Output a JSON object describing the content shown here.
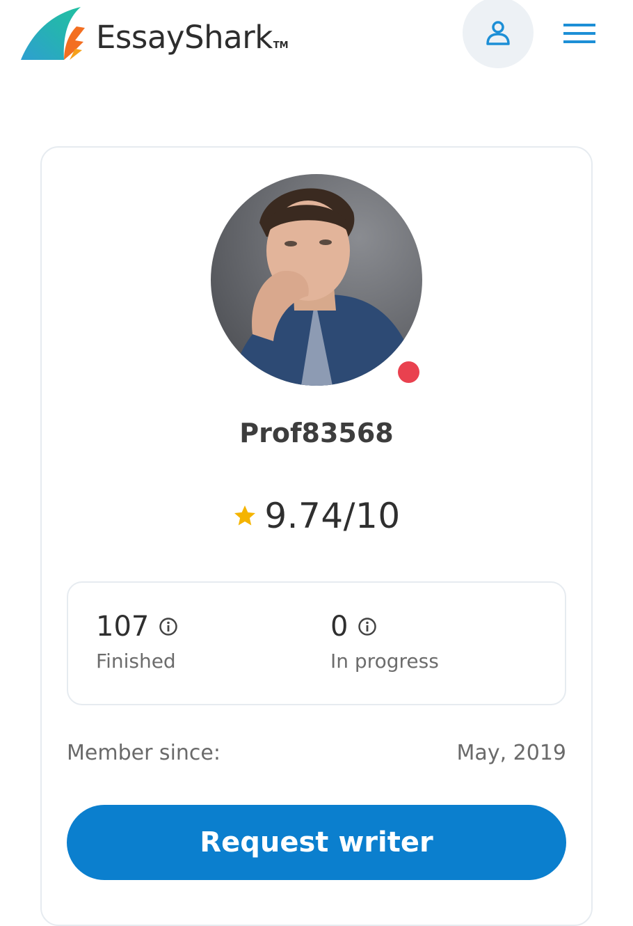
{
  "header": {
    "brand_name": "EssayShark",
    "trademark": "TM",
    "icons": {
      "logo": "essayshark-logo",
      "user": "user-icon",
      "menu": "hamburger-menu-icon"
    }
  },
  "profile": {
    "username": "Prof83568",
    "online_status_color": "#e9414f",
    "rating": {
      "value": "9.74/10",
      "icon": "star-icon",
      "star_color": "#f5b400"
    },
    "stats": {
      "finished": {
        "value": "107",
        "label": "Finished",
        "icon": "info-icon"
      },
      "in_progress": {
        "value": "0",
        "label": "In progress",
        "icon": "info-icon"
      }
    },
    "member_since": {
      "label": "Member since:",
      "value": "May, 2019"
    },
    "request_button": {
      "label": "Request writer",
      "color": "#0b7fce"
    }
  },
  "colors": {
    "accent": "#0b7fce",
    "icon_blue": "#1d8fd6",
    "border": "#e6ebf0"
  }
}
